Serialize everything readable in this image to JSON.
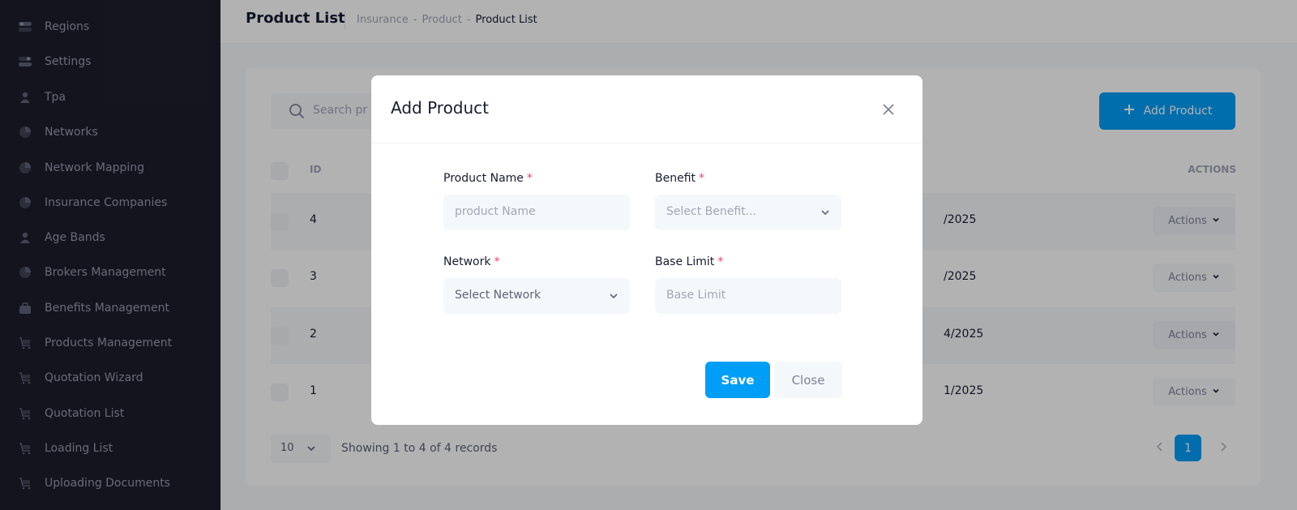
{
  "sidebar": {
    "items": [
      {
        "label": "Regions",
        "icon": "toggle-icon"
      },
      {
        "label": "Settings",
        "icon": "toggle-icon"
      },
      {
        "label": "Tpa",
        "icon": "person-icon"
      },
      {
        "label": "Networks",
        "icon": "pie-chart-icon"
      },
      {
        "label": "Network Mapping",
        "icon": "pie-chart-icon"
      },
      {
        "label": "Insurance Companies",
        "icon": "pie-chart-icon"
      },
      {
        "label": "Age Bands",
        "icon": "person-icon"
      },
      {
        "label": "Brokers Management",
        "icon": "pie-chart-icon"
      },
      {
        "label": "Benefits Management",
        "icon": "briefcase-icon"
      },
      {
        "label": "Products Management",
        "icon": "cart-icon"
      },
      {
        "label": "Quotation Wizard",
        "icon": "cart-icon"
      },
      {
        "label": "Quotation List",
        "icon": "cart-icon"
      },
      {
        "label": "Loading List",
        "icon": "cart-icon"
      },
      {
        "label": "Uploading Documents",
        "icon": "cart-icon"
      }
    ]
  },
  "header": {
    "title": "Product List",
    "breadcrumb": [
      "Insurance",
      "Product",
      "Product List"
    ],
    "separator": "-"
  },
  "list": {
    "search_placeholder": "Search pr",
    "add_button_label": "Add Product",
    "columns": {
      "id": "ID",
      "actions": "ACTIONS"
    },
    "rows": [
      {
        "id": "4",
        "date": "/2025",
        "actions": "Actions"
      },
      {
        "id": "3",
        "date": "/2025",
        "actions": "Actions"
      },
      {
        "id": "2",
        "date": "4/2025",
        "actions": "Actions"
      },
      {
        "id": "1",
        "date": "1/2025",
        "actions": "Actions"
      }
    ],
    "page_size": "10",
    "showing": "Showing 1 to 4 of 4 records",
    "current_page": "1"
  },
  "modal": {
    "title": "Add Product",
    "fields": {
      "product_name": {
        "label": "Product Name",
        "required": "*",
        "placeholder": "product Name"
      },
      "benefit": {
        "label": "Benefit",
        "required": "*",
        "placeholder": "Select Benefit..."
      },
      "network": {
        "label": "Network",
        "required": "*",
        "value": "Select Network"
      },
      "base_limit": {
        "label": "Base Limit",
        "required": "*",
        "placeholder": "Base Limit"
      }
    },
    "save_label": "Save",
    "close_label": "Close"
  },
  "colors": {
    "primary": "#009ef7",
    "sidebar_bg": "#1e1e2d",
    "required": "#f1416c"
  }
}
